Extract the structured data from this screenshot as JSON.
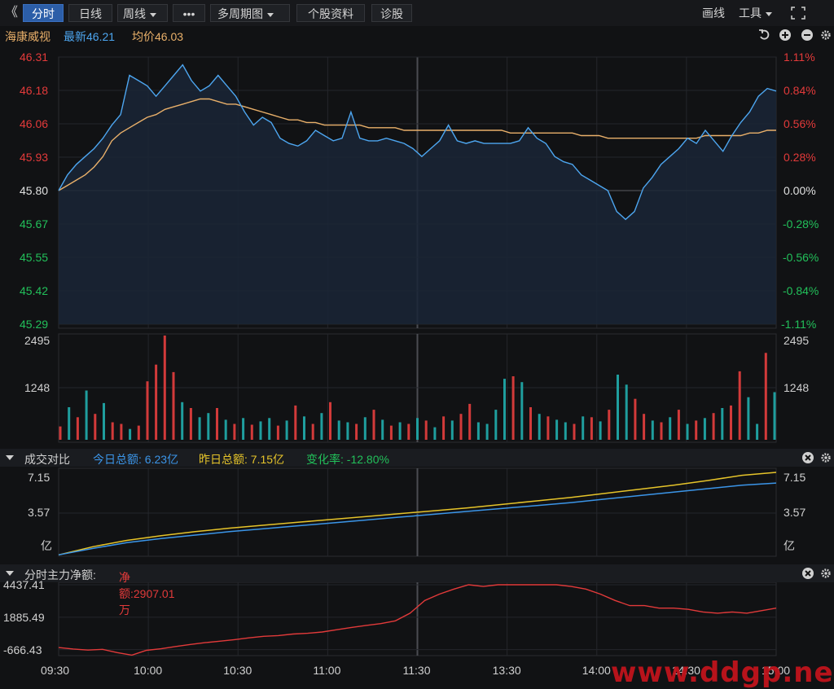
{
  "toolbar": {
    "back": "《",
    "tabs": [
      "分时",
      "日线",
      "周线",
      "•••",
      "多周期图",
      "个股资料",
      "诊股"
    ],
    "right": [
      "画线",
      "工具"
    ]
  },
  "info": {
    "name": "海康威视",
    "latest": "最新46.21",
    "avg": "均价46.03"
  },
  "colors": {
    "up": "#e33a3a",
    "down": "#22c05a",
    "price": "#4da6f0",
    "avg": "#e9b06a",
    "today": "#3b95e8",
    "yesterday": "#e6c42a",
    "net": "#e23a3a"
  },
  "chart_data": [
    {
      "type": "line",
      "name": "price",
      "x_ticks": [
        "09:30",
        "10:00",
        "10:30",
        "11:00",
        "11:30",
        "13:30",
        "14:00",
        "14:30",
        "15:00"
      ],
      "left_ticks": [
        "46.31",
        "46.18",
        "46.06",
        "45.93",
        "45.80",
        "45.67",
        "45.55",
        "45.42",
        "45.29"
      ],
      "right_ticks": [
        "1.11%",
        "0.84%",
        "0.56%",
        "0.28%",
        "0.00%",
        "-0.28%",
        "-0.56%",
        "-0.84%",
        "-1.11%"
      ],
      "ylim": [
        45.29,
        46.31
      ],
      "base": 45.8,
      "series": [
        {
          "name": "price",
          "values": [
            45.8,
            45.86,
            45.9,
            45.93,
            45.96,
            46.0,
            46.05,
            46.09,
            46.24,
            46.22,
            46.2,
            46.16,
            46.2,
            46.24,
            46.28,
            46.22,
            46.18,
            46.2,
            46.24,
            46.2,
            46.16,
            46.1,
            46.05,
            46.08,
            46.06,
            46.0,
            45.98,
            45.97,
            45.99,
            46.03,
            46.01,
            45.99,
            46.0,
            46.1,
            46.0,
            45.99,
            45.99,
            46.0,
            45.99,
            45.98,
            45.96,
            45.93,
            45.96,
            45.99,
            46.05,
            45.99,
            45.98,
            45.99,
            45.98,
            45.98,
            45.98,
            45.98,
            45.99,
            46.04,
            46.0,
            45.98,
            45.93,
            45.91,
            45.9,
            45.86,
            45.84,
            45.82,
            45.8,
            45.72,
            45.69,
            45.72,
            45.81,
            45.85,
            45.9,
            45.93,
            45.96,
            46.0,
            45.98,
            46.03,
            45.99,
            45.95,
            46.01,
            46.06,
            46.1,
            46.16,
            46.19,
            46.18
          ]
        },
        {
          "name": "avg",
          "values": [
            45.8,
            45.82,
            45.84,
            45.86,
            45.89,
            45.93,
            45.99,
            46.02,
            46.04,
            46.06,
            46.08,
            46.09,
            46.11,
            46.12,
            46.13,
            46.14,
            46.15,
            46.15,
            46.14,
            46.13,
            46.13,
            46.12,
            46.11,
            46.1,
            46.09,
            46.08,
            46.07,
            46.07,
            46.06,
            46.06,
            46.05,
            46.05,
            46.05,
            46.05,
            46.05,
            46.04,
            46.04,
            46.04,
            46.04,
            46.03,
            46.03,
            46.03,
            46.03,
            46.03,
            46.03,
            46.03,
            46.03,
            46.03,
            46.03,
            46.03,
            46.03,
            46.02,
            46.02,
            46.02,
            46.02,
            46.02,
            46.02,
            46.02,
            46.02,
            46.01,
            46.01,
            46.01,
            46.0,
            46.0,
            46.0,
            46.0,
            46.0,
            46.0,
            46.0,
            46.0,
            46.0,
            46.0,
            46.0,
            46.01,
            46.01,
            46.01,
            46.01,
            46.01,
            46.02,
            46.02,
            46.03,
            46.03
          ]
        }
      ]
    },
    {
      "type": "bar",
      "name": "volume",
      "left_ticks": [
        "2495",
        "1248"
      ],
      "right_ticks": [
        "2495",
        "1248"
      ],
      "ylim": [
        0,
        2495
      ],
      "values": [
        320,
        780,
        540,
        1180,
        620,
        880,
        420,
        380,
        260,
        340,
        1400,
        1800,
        2495,
        1620,
        900,
        760,
        540,
        640,
        760,
        480,
        380,
        520,
        360,
        440,
        520,
        340,
        460,
        820,
        560,
        380,
        640,
        900,
        460,
        420,
        380,
        540,
        720,
        480,
        340,
        420,
        380,
        520,
        460,
        300,
        560,
        460,
        620,
        860,
        420,
        380,
        720,
        1460,
        1520,
        1380,
        780,
        620,
        560,
        480,
        420,
        380,
        560,
        540,
        440,
        720,
        1560,
        1320,
        980,
        620,
        460,
        420,
        540,
        720,
        380,
        460,
        520,
        640,
        760,
        820,
        1640,
        1020,
        380,
        2080,
        1140
      ],
      "colors": [
        "up",
        "down",
        "up",
        "down",
        "up",
        "down",
        "up",
        "up",
        "down",
        "up",
        "up",
        "up",
        "up",
        "up",
        "down",
        "up",
        "down",
        "down",
        "up",
        "down",
        "up",
        "down",
        "up",
        "down",
        "down",
        "up",
        "down",
        "up",
        "down",
        "up",
        "down",
        "up",
        "down",
        "down",
        "up",
        "down",
        "up",
        "down",
        "up",
        "down",
        "up",
        "down",
        "up",
        "down",
        "up",
        "down",
        "up",
        "up",
        "down",
        "down",
        "down",
        "down",
        "up",
        "down",
        "up",
        "down",
        "up",
        "down",
        "down",
        "up",
        "down",
        "up",
        "down",
        "up",
        "down",
        "down",
        "up",
        "up",
        "down",
        "up",
        "down",
        "up",
        "down",
        "up",
        "down",
        "up",
        "down",
        "up",
        "up",
        "down",
        "down",
        "up",
        "down"
      ]
    },
    {
      "type": "line",
      "name": "turnover",
      "left_ticks": [
        "7.15",
        "3.57",
        "亿"
      ],
      "right_ticks": [
        "7.15",
        "3.57",
        "亿"
      ],
      "ylim": [
        0,
        7.15
      ],
      "series": [
        {
          "name": "今日总额",
          "values": [
            0.05,
            0.6,
            1.1,
            1.45,
            1.75,
            2.05,
            2.3,
            2.55,
            2.8,
            3.05,
            3.3,
            3.55,
            3.8,
            4.05,
            4.3,
            4.55,
            4.85,
            5.15,
            5.45,
            5.75,
            6.05,
            6.23
          ]
        },
        {
          "name": "昨日总额",
          "values": [
            0.05,
            0.75,
            1.3,
            1.7,
            2.05,
            2.35,
            2.6,
            2.85,
            3.1,
            3.35,
            3.6,
            3.85,
            4.1,
            4.4,
            4.7,
            5.0,
            5.35,
            5.7,
            6.05,
            6.45,
            6.9,
            7.15
          ]
        }
      ]
    },
    {
      "type": "line",
      "name": "net",
      "left_ticks": [
        "4437.41",
        "1885.49",
        "-666.43"
      ],
      "ylim": [
        -1200,
        4437.41
      ],
      "series": [
        {
          "name": "净额",
          "values": [
            -500,
            -620,
            -700,
            -640,
            -900,
            -1100,
            -720,
            -600,
            -420,
            -260,
            -120,
            0,
            120,
            260,
            380,
            440,
            560,
            620,
            720,
            900,
            1080,
            1240,
            1380,
            1600,
            2200,
            3200,
            3700,
            4100,
            4440,
            4300,
            4440,
            4440,
            4440,
            4440,
            4440,
            4300,
            4100,
            3700,
            3200,
            2800,
            2800,
            2600,
            2600,
            2500,
            2300,
            2200,
            2300,
            2200,
            2400,
            2600
          ]
        }
      ]
    }
  ],
  "vol_panel": {
    "title": "成交对比",
    "today": "今日总额: 6.23亿",
    "yesterday": "昨日总额: 7.15亿",
    "change": "变化率: -12.80%"
  },
  "net_panel": {
    "title": "分时主力净额:",
    "net": "净额:2907.01万"
  },
  "watermark": "www.ddgp.net"
}
